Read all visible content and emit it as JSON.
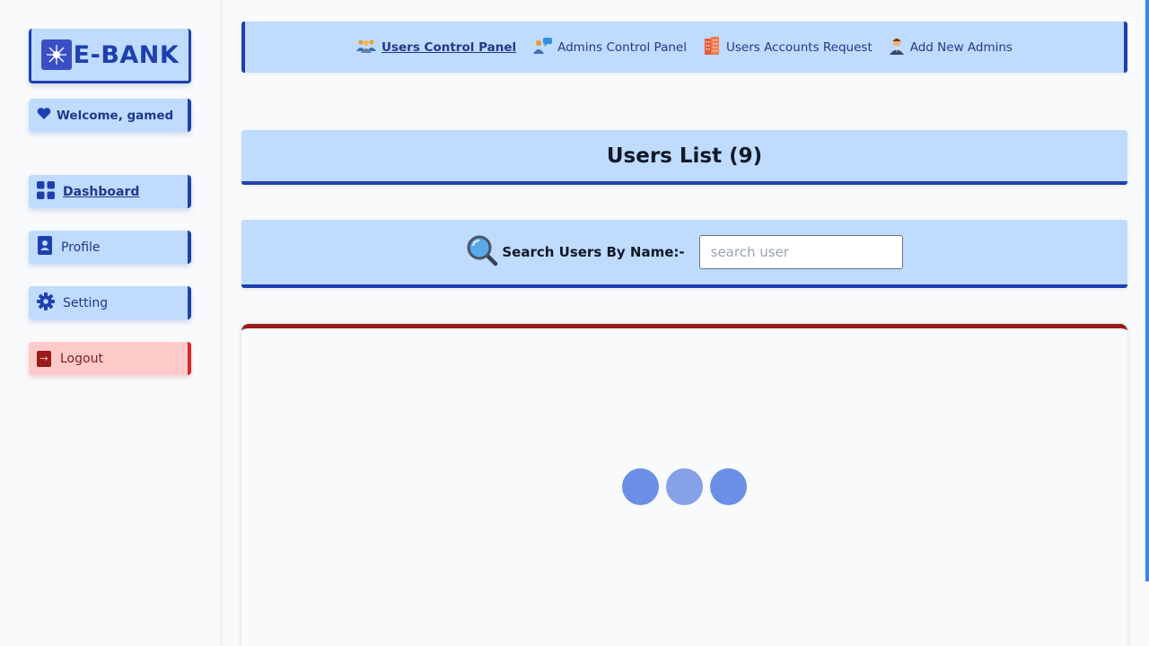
{
  "brand": {
    "name": "E-BANK"
  },
  "sidebar": {
    "welcome": "Welcome, gamed",
    "items": [
      {
        "label": "Dashboard",
        "icon": "grid-icon",
        "active": true
      },
      {
        "label": "Profile",
        "icon": "contact-book-icon",
        "active": false
      },
      {
        "label": "Setting",
        "icon": "gear-icon",
        "active": false
      }
    ],
    "logout": "Logout"
  },
  "topnav": {
    "items": [
      {
        "label": "Users Control Panel",
        "icon": "users-group-icon",
        "active": true
      },
      {
        "label": "Admins Control Panel",
        "icon": "admin-chat-icon",
        "active": false
      },
      {
        "label": "Users Accounts Request",
        "icon": "building-icon",
        "active": false
      },
      {
        "label": "Add New Admins",
        "icon": "admin-person-icon",
        "active": false
      }
    ]
  },
  "users_list": {
    "title": "Users List (9)"
  },
  "search": {
    "label": "Search Users By Name:-",
    "placeholder": "search user",
    "value": ""
  },
  "loader": {
    "dot_colors": [
      "#6b8fe6",
      "#86a1e8",
      "#6b8fe6"
    ]
  },
  "colors": {
    "primary": "#1e40af",
    "panel": "#bfdbfe",
    "danger": "#dc2626",
    "danger_bg": "#fecaca"
  }
}
